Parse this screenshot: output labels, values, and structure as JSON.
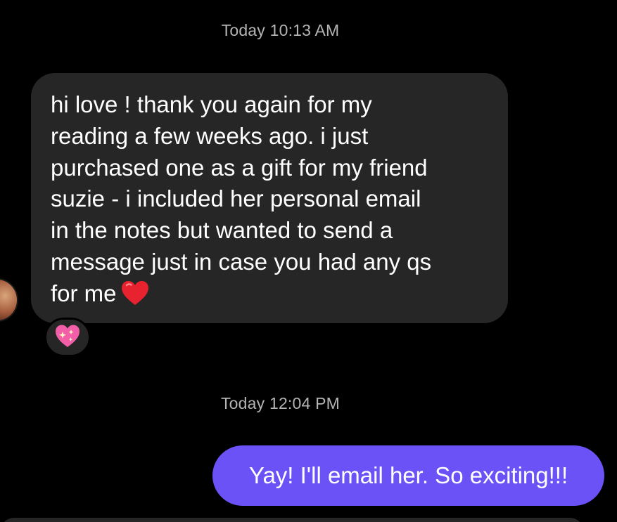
{
  "thread": {
    "timestamp_1": "Today 10:13 AM",
    "incoming_message": "hi love ! thank you again for my\nreading a few weeks ago. i just\npurchased one as a gift for my friend\nsuzie - i included her personal email\nin the notes but wanted to send a\nmessage just in case you had any qs\nfor me",
    "incoming_emoji": "red-heart-icon",
    "reaction_emoji": "sparkling-heart-icon",
    "timestamp_2": "Today 12:04 PM",
    "outgoing_message": "Yay! I'll email her. So exciting!!!"
  },
  "colors": {
    "background": "#000000",
    "incoming_bubble": "#262626",
    "outgoing_bubble": "#6b52f7",
    "timestamp_text": "#b4b4b4"
  }
}
